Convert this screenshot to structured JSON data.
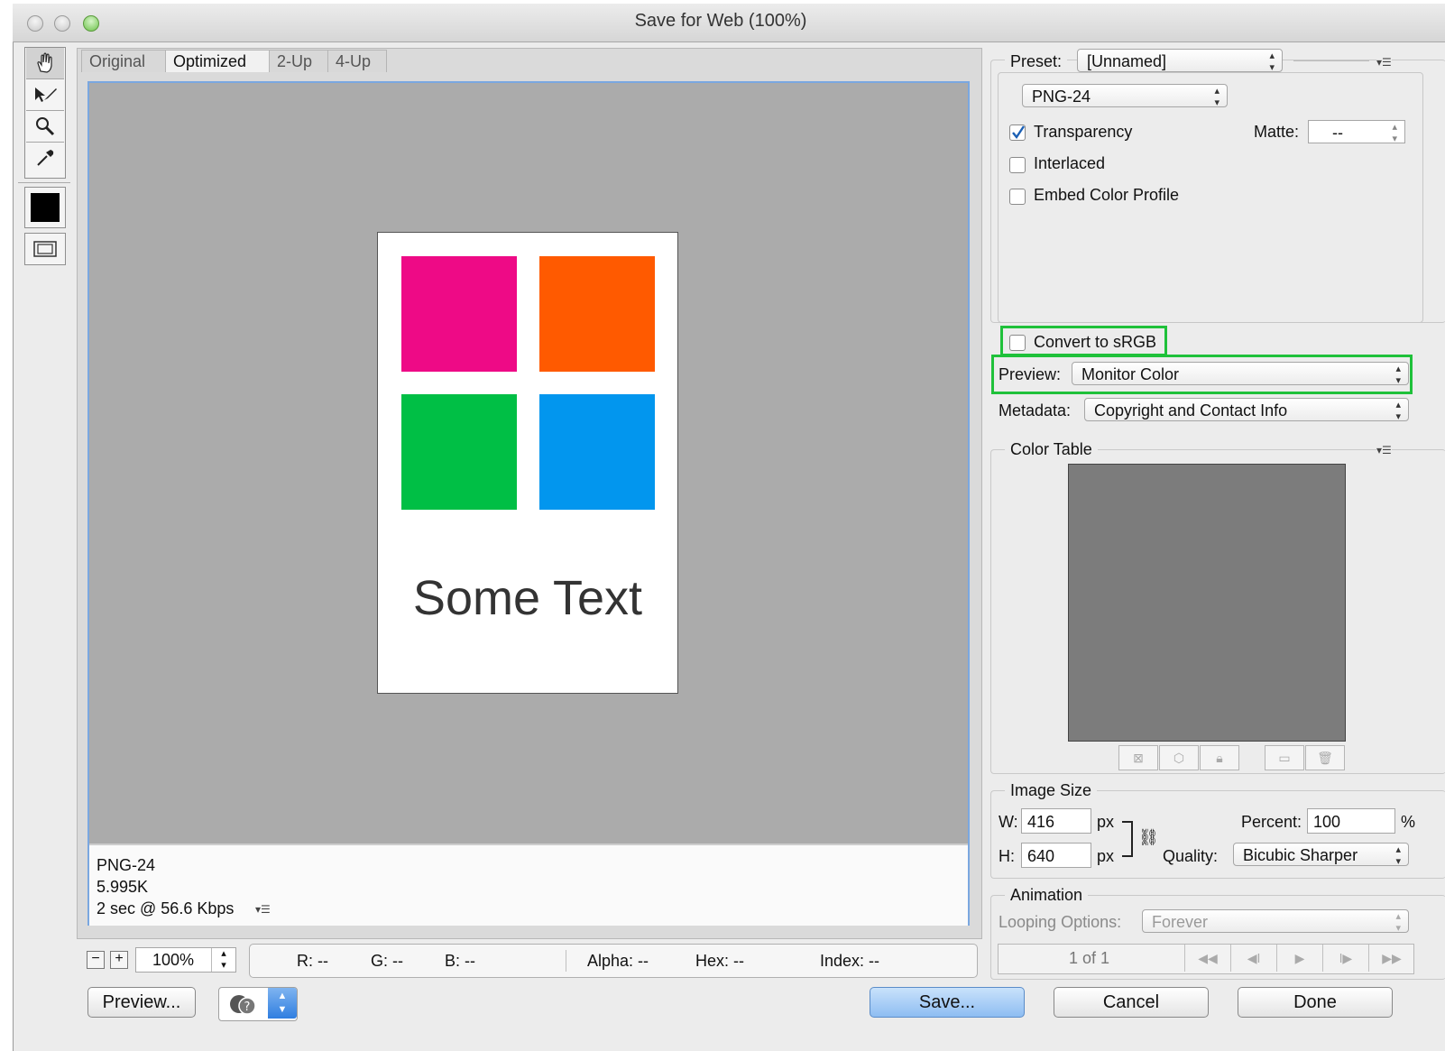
{
  "window": {
    "title": "Save for Web (100%)"
  },
  "colors": {
    "pink": "#ee0a86",
    "orange": "#ff5a00",
    "green": "#00bf45",
    "blue": "#0296ee",
    "highlight": "#1fc13a",
    "color_table": "#7c7c7c"
  },
  "tools": {
    "items": [
      "hand-tool-icon",
      "slice-select-icon",
      "zoom-icon",
      "eyedropper-icon",
      "eyedropper-color-swatch",
      "toggle-slices-icon"
    ]
  },
  "tabs": [
    "Original",
    "Optimized",
    "2-Up",
    "4-Up"
  ],
  "preview": {
    "text": "Some Text",
    "info_format": "PNG-24",
    "info_size": "5.995K",
    "info_time": "2 sec @ 56.6 Kbps"
  },
  "bottom": {
    "zoom": "100%",
    "r": "R: --",
    "g": "G: --",
    "b": "B: --",
    "alpha": "Alpha: --",
    "hex": "Hex: --",
    "index": "Index: --",
    "preview_button": "Preview...",
    "save_button": "Save...",
    "cancel_button": "Cancel",
    "done_button": "Done"
  },
  "settings": {
    "preset_label": "Preset:",
    "preset_value": "[Unnamed]",
    "format_value": "PNG-24",
    "transparency_label": "Transparency",
    "transparency_checked": true,
    "matte_label": "Matte:",
    "matte_value": "--",
    "interlaced_label": "Interlaced",
    "embed_label": "Embed Color Profile",
    "srgb_label": "Convert to sRGB",
    "preview_label": "Preview:",
    "preview_value": "Monitor Color",
    "metadata_label": "Metadata:",
    "metadata_value": "Copyright and Contact Info"
  },
  "color_table": {
    "title": "Color Table"
  },
  "image_size": {
    "title": "Image Size",
    "w_label": "W:",
    "w_value": "416",
    "w_unit": "px",
    "h_label": "H:",
    "h_value": "640",
    "h_unit": "px",
    "percent_label": "Percent:",
    "percent_value": "100",
    "percent_unit": "%",
    "quality_label": "Quality:",
    "quality_value": "Bicubic Sharper"
  },
  "animation": {
    "title": "Animation",
    "looping_label": "Looping Options:",
    "looping_value": "Forever",
    "frame_counter": "1 of 1"
  }
}
